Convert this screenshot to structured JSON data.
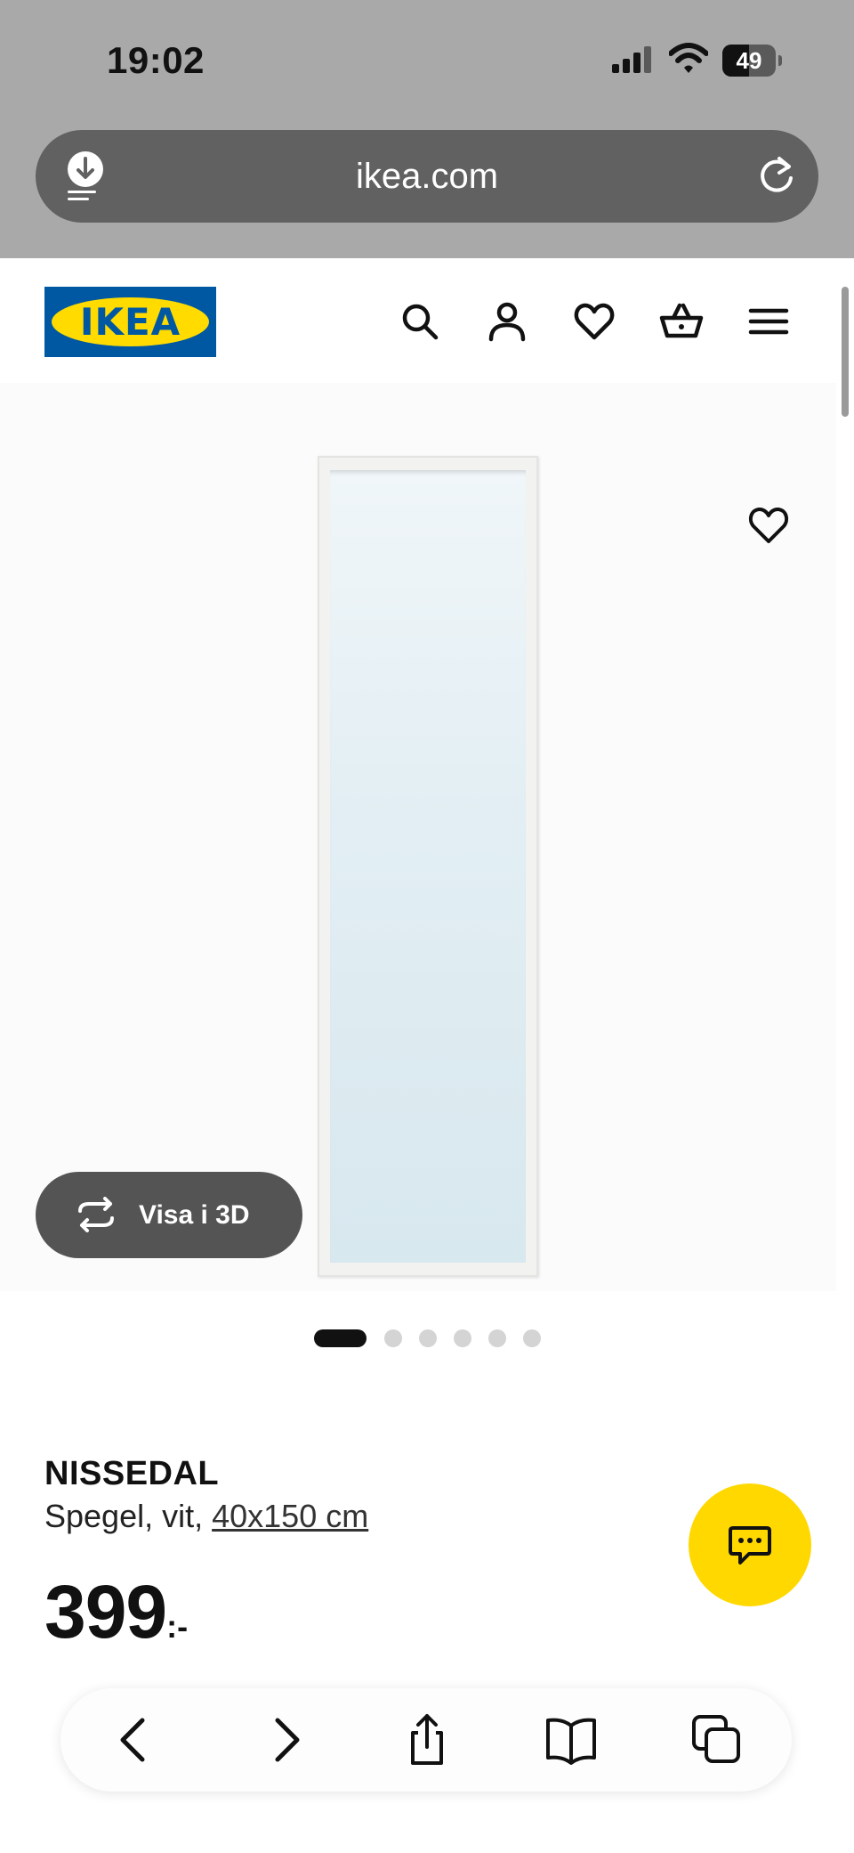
{
  "status_bar": {
    "time": "19:02",
    "battery": "49"
  },
  "browser": {
    "url": "ikea.com"
  },
  "header": {
    "logo_text": "IKEA",
    "icons": [
      "search-icon",
      "account-icon",
      "heart-icon",
      "shopping-basket-icon",
      "hamburger-menu-icon"
    ]
  },
  "gallery": {
    "view_3d_label": "Visa i 3D",
    "dots_total": 6,
    "active_dot": 1
  },
  "product": {
    "name": "NISSEDAL",
    "desc_prefix": "Spegel, vit, ",
    "size": "40x150 cm",
    "price": "399",
    "price_suffix": ":-"
  },
  "toolbar": {
    "icons": [
      "back-arrow-icon",
      "forward-arrow-icon",
      "share-icon",
      "bookmarks-icon",
      "tabs-icon"
    ]
  },
  "colors": {
    "ikea_blue": "#0058a3",
    "ikea_yellow": "#ffdb00",
    "chat_yellow": "#ffd800",
    "chrome_gray": "#a9a9a9",
    "url_bar": "#616161"
  }
}
